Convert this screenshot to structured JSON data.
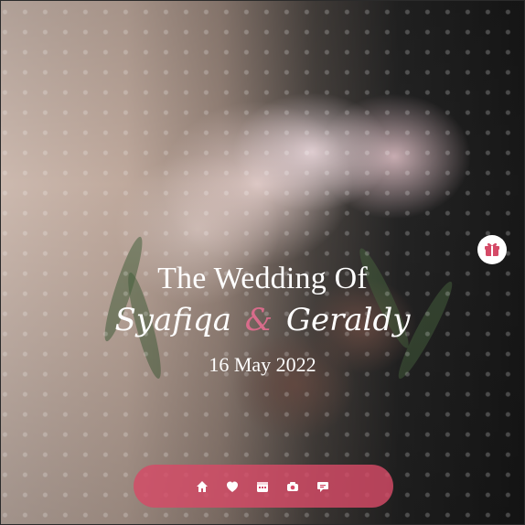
{
  "hero": {
    "title": "The Wedding Of",
    "name_one": "Syafiqa",
    "ampersand": "&",
    "name_two": "Geraldy",
    "date": "16 May 2022"
  },
  "icons": {
    "gift": "gift-icon",
    "nav": [
      "home-icon",
      "heart-icon",
      "calendar-icon",
      "camera-icon",
      "chat-icon"
    ]
  },
  "colors": {
    "accent": "#d54a67",
    "ampersand": "#d86c8b"
  }
}
